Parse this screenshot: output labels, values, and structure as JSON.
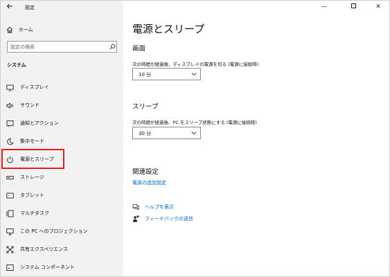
{
  "window": {
    "title": "設定",
    "back_icon": "arrow-left-icon",
    "minimize_glyph": "—",
    "close_glyph": "✕"
  },
  "sidebar": {
    "home_label": "ホーム",
    "search_placeholder": "設定の検索",
    "section_label": "システム",
    "items": [
      {
        "label": "ディスプレイ",
        "icon": "display-icon"
      },
      {
        "label": "サウンド",
        "icon": "speaker-icon"
      },
      {
        "label": "通知とアクション",
        "icon": "notification-icon"
      },
      {
        "label": "集中モード",
        "icon": "moon-icon"
      },
      {
        "label": "電源とスリープ",
        "icon": "power-icon",
        "selected": true
      },
      {
        "label": "ストレージ",
        "icon": "storage-icon"
      },
      {
        "label": "タブレット",
        "icon": "tablet-icon"
      },
      {
        "label": "マルチタスク",
        "icon": "multitask-icon"
      },
      {
        "label": "この PC へのプロジェクション",
        "icon": "projection-icon"
      },
      {
        "label": "共有エクスペリエンス",
        "icon": "share-icon"
      },
      {
        "label": "システム コンポーネント",
        "icon": "components-icon"
      }
    ]
  },
  "main": {
    "title": "電源とスリープ",
    "screen": {
      "heading": "画面",
      "description": "次の時間が経過後、ディスプレイの電源を切る (電源に接続時)",
      "value": "10 分"
    },
    "sleep": {
      "heading": "スリープ",
      "description": "次の時間が経過後、PC をスリープ状態にする (電源に接続時)",
      "value": "30 分"
    },
    "related": {
      "heading": "関連設定",
      "link": "電源の追加設定"
    },
    "help_label": "ヘルプを表示",
    "feedback_label": "フィードバックの送信"
  },
  "colors": {
    "accent": "#0067c0",
    "highlight": "#e31b23",
    "sidebar_bg": "#f2f2f2"
  }
}
